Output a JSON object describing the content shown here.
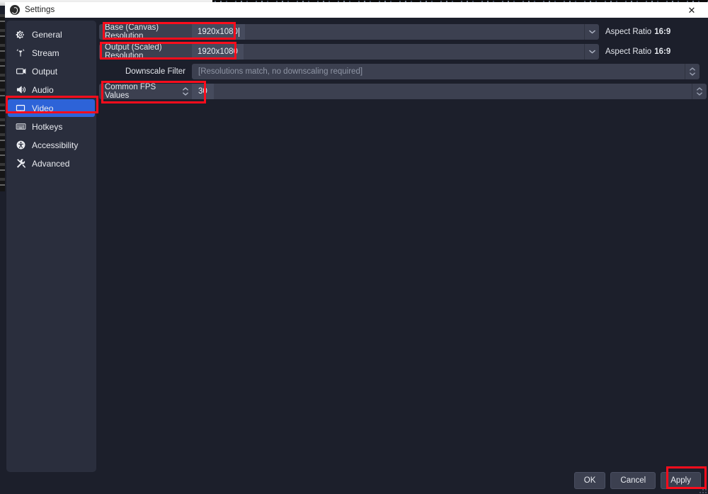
{
  "window": {
    "title": "Settings",
    "logo_icon": "obs-logo-icon",
    "close_icon": "close-icon",
    "close_glyph": "✕"
  },
  "sidebar": {
    "items": [
      {
        "label": "General",
        "icon": "gear-icon",
        "active": false
      },
      {
        "label": "Stream",
        "icon": "broadcast-icon",
        "active": false
      },
      {
        "label": "Output",
        "icon": "output-screen-icon",
        "active": false
      },
      {
        "label": "Audio",
        "icon": "speaker-icon",
        "active": false
      },
      {
        "label": "Video",
        "icon": "monitor-icon",
        "active": true
      },
      {
        "label": "Hotkeys",
        "icon": "keyboard-icon",
        "active": false
      },
      {
        "label": "Accessibility",
        "icon": "accessibility-icon",
        "active": false
      },
      {
        "label": "Advanced",
        "icon": "wrench-icon",
        "active": false
      }
    ]
  },
  "video_settings": {
    "base_resolution": {
      "label": "Base (Canvas) Resolution",
      "value": "1920x1080",
      "has_caret": true,
      "aspect_prefix": "Aspect Ratio",
      "aspect_value": "16:9",
      "dropdown_icon": "chevron-down-icon"
    },
    "output_resolution": {
      "label": "Output (Scaled) Resolution",
      "value": "1920x1080",
      "has_caret": false,
      "aspect_prefix": "Aspect Ratio",
      "aspect_value": "16:9",
      "dropdown_icon": "chevron-down-icon"
    },
    "downscale_filter": {
      "label": "Downscale Filter",
      "placeholder": "[Resolutions match, no downscaling required]",
      "spinner_icon": "spinner-updown-icon"
    },
    "fps": {
      "type_label": "Common FPS Values",
      "value": "30",
      "type_spinner_icon": "spinner-updown-icon",
      "spinner_icon": "spinner-updown-icon"
    }
  },
  "footer": {
    "ok_label": "OK",
    "cancel_label": "Cancel",
    "apply_label": "Apply"
  },
  "annotations": {
    "color": "#fc0d1c",
    "boxes": [
      "base-canvas-resolution-row",
      "output-scaled-resolution-row",
      "common-fps-values-row",
      "sidebar-item-video",
      "apply-button"
    ]
  }
}
